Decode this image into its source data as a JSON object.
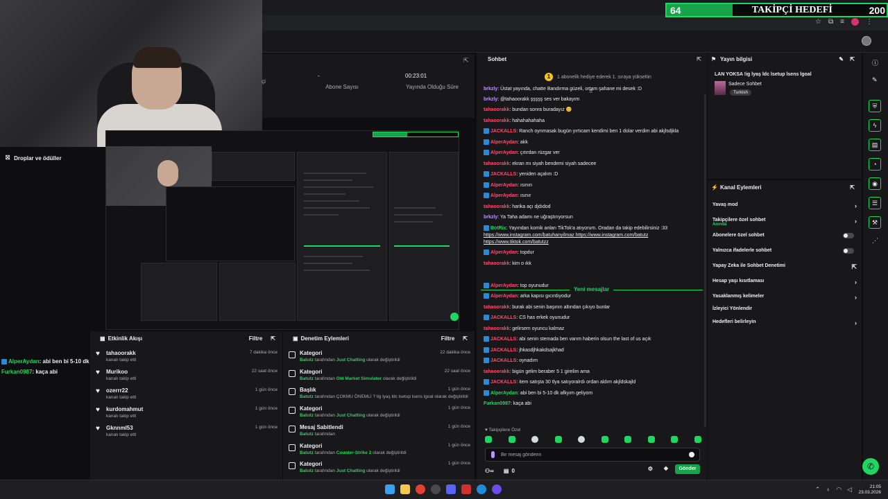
{
  "goal": {
    "start": "64",
    "title": "TAKİPÇİ HEDEFİ",
    "end": "200",
    "progress": 0.3
  },
  "stats": [
    {
      "value": "",
      "label": "çi"
    },
    {
      "value": "-",
      "label": "Abone Sayısı"
    },
    {
      "value": "00:23:01",
      "label": "Yayında Olduğu Süre"
    }
  ],
  "drops_label": "Droplar ve ödüller",
  "activity": {
    "title": "Etkinlik Akışı",
    "filter": "Filtre",
    "items": [
      {
        "user": "tahaoorakk",
        "desc": "kanalı takip etti",
        "time": "7 dakika önce"
      },
      {
        "user": "Murikoo",
        "desc": "kanalı takip etti",
        "time": "22 saat önce"
      },
      {
        "user": "ozerrr22",
        "desc": "kanalı takip etti",
        "time": "1 gün önce"
      },
      {
        "user": "kurdomahmut",
        "desc": "kanalı takip etti",
        "time": "1 gün önce"
      },
      {
        "user": "Gknnml53",
        "desc": "kanalı takip etti",
        "time": "1 gün önce"
      }
    ]
  },
  "moderation": {
    "title": "Denetim Eylemleri",
    "filter": "Filtre",
    "items": [
      {
        "title": "Kategori",
        "by": "Batutz",
        "mid": "tarafından",
        "value": "Just Chatting",
        "suffix": "olarak değiştirildi",
        "time": "22 dakika önce"
      },
      {
        "title": "Kategori",
        "by": "Batutz",
        "mid": "tarafından",
        "value": "Old Market Simulator",
        "suffix": "olarak değiştirildi",
        "time": "22 saat önce"
      },
      {
        "title": "Başlık",
        "by": "Batutz",
        "mid": "tarafından",
        "value": "",
        "suffix": "ÇOKMU ÖNEMLİ ? lig lyaş ldc lsetup lsens lgoal olarak değiştirildi",
        "time": "1 gün önce"
      },
      {
        "title": "Kategori",
        "by": "Batutz",
        "mid": "tarafından",
        "value": "Just Chatting",
        "suffix": "olarak değiştirildi",
        "time": "1 gün önce"
      },
      {
        "title": "Mesaj Sabitlendi",
        "by": "Batutz",
        "mid": "tarafından",
        "value": "",
        "suffix": "",
        "time": "1 gün önce"
      },
      {
        "title": "Kategori",
        "by": "Batutz",
        "mid": "tarafından",
        "value": "Counter-Strike 2",
        "suffix": "olarak değiştirildi",
        "time": "1 gün önce"
      },
      {
        "title": "Kategori",
        "by": "Batutz",
        "mid": "tarafından",
        "value": "Just Chatting",
        "suffix": "olarak değiştirildi",
        "time": "1 gün önce"
      }
    ]
  },
  "overlay_chat": [
    {
      "name": "AlperAydan",
      "text": ": abi ben bi 5-10 dk afkyım geliyom"
    },
    {
      "name": "Furkan0987",
      "text": ": kaça abi"
    }
  ],
  "chat": {
    "title": "Sohbet",
    "hype": "1 abonelik hediye ederek 1. sıraya yükseltin",
    "messages": [
      {
        "name": "brkzly",
        "color": "#bf94ff",
        "text": ": Üstat yayında, chatte Bandırma güzeli, ortam şahane mi desek :D",
        "badge": false
      },
      {
        "name": "brkzly",
        "color": "#bf94ff",
        "text": ": @tahaoorakk şşşşş ses ver bakayım",
        "badge": false
      },
      {
        "name": "tahaoorakk",
        "color": "#ff4d6d",
        "text": ": bundan sonra buradayız 😊",
        "badge": false
      },
      {
        "name": "tahaoorakk",
        "color": "#ff4d6d",
        "text": ": hahahahahaha",
        "badge": false
      },
      {
        "name": "JACKALLS",
        "color": "#ff4d6d",
        "text": ": Ranch oynmasak bugün yırtıcam kendimi ben 1 dolar verdim abi akjlsdjkla",
        "badge": true
      },
      {
        "name": "AlperAydan",
        "color": "#ff4d6d",
        "text": ": akk",
        "badge": true
      },
      {
        "name": "AlperAydan",
        "color": "#ff4d6d",
        "text": ": çıtırdan rüzgar ver",
        "badge": true
      },
      {
        "name": "tahaoorakk",
        "color": "#ff4d6d",
        "text": ": ekran mı siyah bendemi siyah sadecee",
        "badge": false
      },
      {
        "name": "JACKALLS",
        "color": "#ff4d6d",
        "text": ": yeniden açalım :D",
        "badge": true
      },
      {
        "name": "AlperAydan",
        "color": "#ff4d6d",
        "text": ": ısının",
        "badge": true
      },
      {
        "name": "AlperAydan",
        "color": "#ff4d6d",
        "text": ": ısınır",
        "badge": true
      },
      {
        "name": "tahaoorakk",
        "color": "#ff4d6d",
        "text": ": harika açı djdıdod",
        "badge": false
      },
      {
        "name": "brkzly",
        "color": "#bf94ff",
        "text": ": Ya Taha adamı ne uğraştırıyorsun",
        "badge": false
      },
      {
        "name": "BotRix",
        "color": "#1ed760",
        "text": ": Yayından komik anları TikTok'a atıyorum. Oradan da takip edebilirsiniz :33",
        "badge": true
      },
      {
        "name": "",
        "color": "#efeff1",
        "text": "https://www.instagram.com/batuhanyilmaz https://www.instagram.com/batutz",
        "badge": false,
        "link": true
      },
      {
        "name": "",
        "color": "#efeff1",
        "text": "https://www.tiktok.com/batutzz",
        "badge": false,
        "link": true
      },
      {
        "name": "AlperAydan",
        "color": "#ff4d6d",
        "text": ": topdur",
        "badge": true
      },
      {
        "name": "tahaoorakk",
        "color": "#ff4d6d",
        "text": ": kim o ıkk",
        "badge": false
      }
    ],
    "new_label": "Yeni mesajlar",
    "new_messages": [
      {
        "name": "AlperAydan",
        "color": "#ff4d6d",
        "text": ": top oyunudur",
        "badge": true
      },
      {
        "name": "AlperAydan",
        "color": "#ff4d6d",
        "text": ": arka kapısı gıcırdıyodur",
        "badge": true
      },
      {
        "name": "tahaoorakk",
        "color": "#ff4d6d",
        "text": ": burak abi senin başının altından çıkıyo bunlar",
        "badge": false
      },
      {
        "name": "JACKALLS",
        "color": "#ff4d6d",
        "text": ": CS has erkek oyunudur",
        "badge": true
      },
      {
        "name": "tahaoorakk",
        "color": "#ff4d6d",
        "text": ": gelirsem oyuncu kalmaz",
        "badge": false
      },
      {
        "name": "JACKALLS",
        "color": "#ff4d6d",
        "text": ": abi senin stemada ben varım haberin olsun the last of us açık",
        "badge": true
      },
      {
        "name": "JACKALLS",
        "color": "#ff4d6d",
        "text": ": jhkasdjhkakdsajkhad",
        "badge": true
      },
      {
        "name": "JACKALLS",
        "color": "#ff4d6d",
        "text": ": oynadım",
        "badge": true
      },
      {
        "name": "tahaoorakk",
        "color": "#ff4d6d",
        "text": ": bigün gelim beraber 5 1 girelim ama",
        "badge": false
      },
      {
        "name": "JACKALLS",
        "color": "#ff4d6d",
        "text": ": item satışta 30 tlya satıyoralrdı ordan aldım akjldskajld",
        "badge": true
      },
      {
        "name": "AlperAydan",
        "color": "#1ed760",
        "text": ": abi ben bi 5-10 dk afkyım geliyom",
        "badge": true
      },
      {
        "name": "Furkan0987",
        "color": "#1ed760",
        "text": ": kaça abi",
        "badge": false
      }
    ],
    "subs_only": "Takipçilere Özel",
    "input_placeholder": "Bir mesaj gönderin",
    "foot_count": "0",
    "send_label": "Gönder"
  },
  "stream_info": {
    "title": "Yayın bilgisi",
    "stream_title": "LAN YOKSA !ig lyaş ldc lsetup lsens lgoal",
    "category": "Sadece Sohbet",
    "language": "Turkish"
  },
  "channel_actions": {
    "title": "Kanal Eylemleri",
    "items": [
      {
        "label": "Yavaş mod",
        "sub": "",
        "ctrl": "chev"
      },
      {
        "label": "Takipçilere özel sohbet",
        "sub": "Anında",
        "ctrl": "chev"
      },
      {
        "label": "Abonelere özel sohbet",
        "sub": "",
        "ctrl": "toggle"
      },
      {
        "label": "Yalnızca ifadelerle sohbet",
        "sub": "",
        "ctrl": "toggle"
      },
      {
        "label": "Yapay Zeka ile Sohbet Denetimi",
        "sub": "",
        "ctrl": "ext"
      },
      {
        "label": "Hesap yaşı kısıtlaması",
        "sub": "",
        "ctrl": "chev"
      },
      {
        "label": "Yasaklanmış kelimeler",
        "sub": "",
        "ctrl": "chev"
      },
      {
        "label": "İzleyici Yönlendir",
        "sub": "",
        "ctrl": "none"
      },
      {
        "label": "Hedefleri belirleyin",
        "sub": "",
        "ctrl": "chev"
      }
    ]
  },
  "clock": {
    "time": "21:05",
    "date": "23.03.2026"
  }
}
